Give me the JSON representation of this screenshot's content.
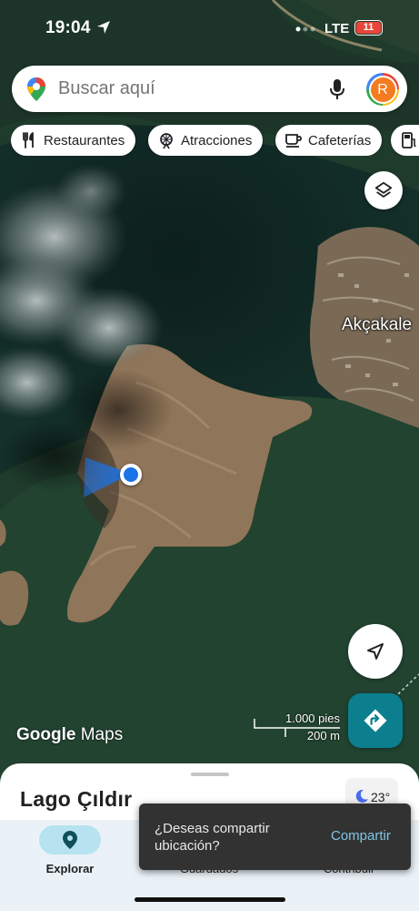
{
  "status_bar": {
    "time": "19:04",
    "network": "LTE",
    "battery": "11"
  },
  "search": {
    "placeholder": "Buscar aquí",
    "avatar_initial": "R"
  },
  "chips": [
    {
      "label": "Restaurantes",
      "icon": "fork-knife-icon"
    },
    {
      "label": "Atracciones",
      "icon": "ferris-wheel-icon"
    },
    {
      "label": "Cafeterías",
      "icon": "coffee-cup-icon"
    },
    {
      "label": "",
      "icon": "gas-station-icon"
    }
  ],
  "map": {
    "place_label": "Akçakale",
    "attribution_prefix": "Google",
    "attribution_suffix": "Maps",
    "scale_feet": "1.000 pies",
    "scale_meters": "200 m"
  },
  "sheet": {
    "place_name": "Lago Çıldır",
    "temperature": "23°"
  },
  "snackbar": {
    "message": "¿Deseas compartir ubicación?",
    "action": "Compartir"
  },
  "nav": [
    {
      "label": "Explorar",
      "icon": "explore-pin-icon",
      "active": true
    },
    {
      "label": "Guardados",
      "icon": "bookmark-icon",
      "active": false
    },
    {
      "label": "Contribuir",
      "icon": "add-contribution-icon",
      "active": false
    }
  ],
  "colors": {
    "accent": "#0b7f8e",
    "location_blue": "#1a73e8",
    "active_nav_pill": "#b6e3ef"
  }
}
